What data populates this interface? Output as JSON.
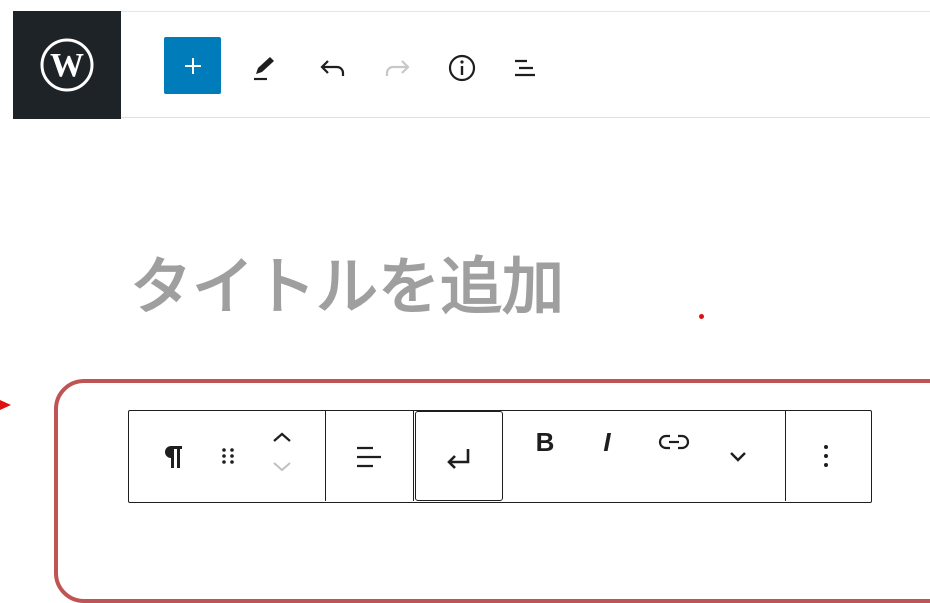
{
  "header": {
    "logo_icon": "wordpress-icon",
    "inserter_icon": "plus-icon",
    "tool_icons": [
      "pencil-icon",
      "undo-icon",
      "redo-icon",
      "info-icon",
      "list-view-icon"
    ],
    "accent_color": "#007cba"
  },
  "editor": {
    "title_placeholder": "タイトルを追加"
  },
  "block_toolbar": {
    "icons": [
      "paragraph-icon",
      "drag-handle-icon",
      "move-up-icon",
      "move-down-icon",
      "align-left-icon",
      "enter-icon",
      "link-icon",
      "chevron-down-icon",
      "more-options-icon"
    ],
    "bold_label": "B",
    "italic_label": "I"
  }
}
